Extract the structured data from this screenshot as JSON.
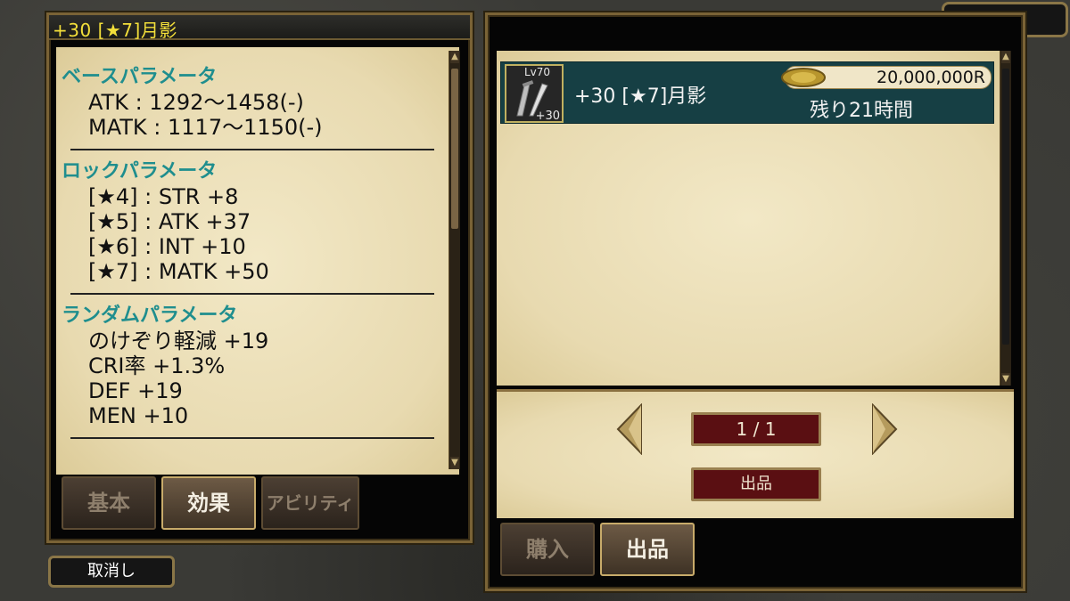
{
  "left_panel": {
    "title": "+30 [★7]月影",
    "base": {
      "heading": "ベースパラメータ",
      "lines": [
        "ATK : 1292～1458(-)",
        "MATK : 1117～1150(-)"
      ]
    },
    "lock": {
      "heading": "ロックパラメータ",
      "lines": [
        "[★4] : STR +8",
        "[★5] : ATK +37",
        "[★6] : INT +10",
        "[★7] : MATK +50"
      ]
    },
    "random": {
      "heading": "ランダムパラメータ",
      "lines": [
        "のけぞり軽減 +19",
        "CRI率 +1.3%",
        "DEF +19",
        "MEN +10"
      ]
    },
    "tabs": [
      {
        "label": "基本",
        "active": false
      },
      {
        "label": "効果",
        "active": true
      },
      {
        "label": "アビリティ",
        "active": false
      }
    ]
  },
  "cancel_label": "取消し",
  "close_label": "✕",
  "right_panel": {
    "listing": {
      "level": "Lv70",
      "enhance": "+30",
      "name": "+30 [★7]月影",
      "price": "20,000,000R",
      "time_left": "残り21時間"
    },
    "page_indicator": "1 / 1",
    "list_button": "出品",
    "tabs": [
      {
        "label": "購入",
        "active": false
      },
      {
        "label": "出品",
        "active": true
      }
    ]
  },
  "colors": {
    "title_yellow": "#f3df3a",
    "section_teal": "#1f8e8e",
    "listing_bg": "#163f44",
    "gold_border": "#8d7443"
  }
}
